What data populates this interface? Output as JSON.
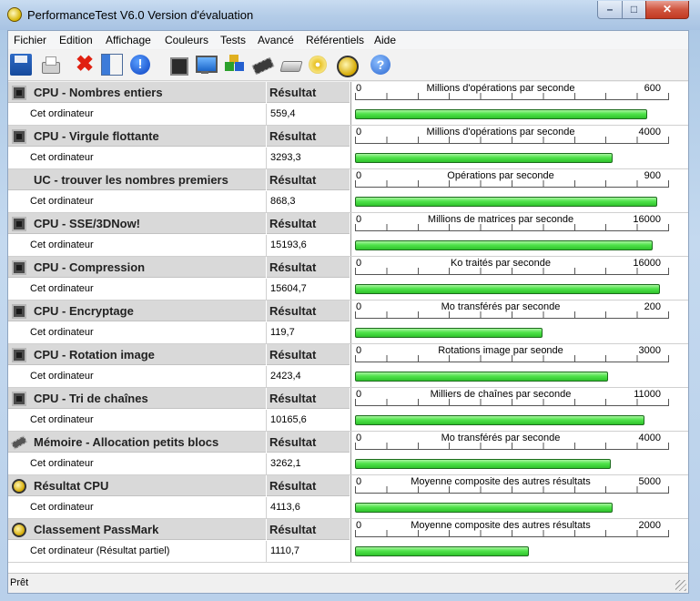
{
  "window": {
    "title": "PerformanceTest V6.0 Version d'évaluation",
    "buttons": {
      "minimize": "–",
      "maximize": "□",
      "close": "✕"
    }
  },
  "menu": [
    "Fichier",
    "Edition",
    "Affichage",
    "Couleurs",
    "Tests",
    "Avancé",
    "Référentiels",
    "Aide"
  ],
  "toolbar": {
    "icons": [
      "save-icon",
      "print-icon",
      "delete-icon",
      "report-icon",
      "info-icon",
      "stop-icon",
      "monitor-icon",
      "cubes-icon",
      "memory-chip-icon",
      "disk-drive-icon",
      "cd-icon",
      "passmark-icon",
      "help-icon"
    ],
    "delete_glyph": "✖",
    "info_glyph": "!",
    "help_glyph": "?"
  },
  "colors": {
    "bar_green": "#4fe34a",
    "header_gray": "#d9d9d9"
  },
  "result_col": "Résultat",
  "tests": [
    {
      "name": "CPU - Nombres entiers",
      "icon": "chip-icon",
      "who": "Cet ordinateur",
      "value": "559,4",
      "unit": "Millions d'opérations par seconde",
      "min": "0",
      "max": "600",
      "fraction": 0.932
    },
    {
      "name": "CPU - Virgule flottante",
      "icon": "chip-icon",
      "who": "Cet ordinateur",
      "value": "3293,3",
      "unit": "Millions d'opérations par seconde",
      "min": "0",
      "max": "4000",
      "fraction": 0.823
    },
    {
      "name": "UC - trouver les nombres premiers",
      "icon": "none",
      "who": "Cet ordinateur",
      "value": "868,3",
      "unit": "Opérations par seconde",
      "min": "0",
      "max": "900",
      "fraction": 0.965
    },
    {
      "name": "CPU - SSE/3DNow!",
      "icon": "chip-icon",
      "who": "Cet ordinateur",
      "value": "15193,6",
      "unit": "Millions de matrices par seconde",
      "min": "0",
      "max": "16000",
      "fraction": 0.95
    },
    {
      "name": "CPU - Compression",
      "icon": "chip-icon",
      "who": "Cet ordinateur",
      "value": "15604,7",
      "unit": "Ko traités par seconde",
      "min": "0",
      "max": "16000",
      "fraction": 0.975
    },
    {
      "name": "CPU - Encryptage",
      "icon": "chip-icon",
      "who": "Cet ordinateur",
      "value": "119,7",
      "unit": "Mo transférés par seconde",
      "min": "0",
      "max": "200",
      "fraction": 0.599
    },
    {
      "name": "CPU - Rotation image",
      "icon": "chip-icon",
      "who": "Cet ordinateur",
      "value": "2423,4",
      "unit": "Rotations image par seonde",
      "min": "0",
      "max": "3000",
      "fraction": 0.808
    },
    {
      "name": "CPU - Tri de chaînes",
      "icon": "chip-icon",
      "who": "Cet ordinateur",
      "value": "10165,6",
      "unit": "Milliers de chaînes par seconde",
      "min": "0",
      "max": "11000",
      "fraction": 0.924
    },
    {
      "name": "Mémoire - Allocation petits blocs",
      "icon": "memory-icon",
      "who": "Cet ordinateur",
      "value": "3262,1",
      "unit": "Mo transférés par seconde",
      "min": "0",
      "max": "4000",
      "fraction": 0.816
    },
    {
      "name": "Résultat CPU",
      "icon": "passmark-icon",
      "who": "Cet ordinateur",
      "value": "4113,6",
      "unit": "Moyenne composite des autres résultats",
      "min": "0",
      "max": "5000",
      "fraction": 0.823
    },
    {
      "name": "Classement PassMark",
      "icon": "passmark-icon",
      "who": "Cet ordinateur (Résultat partiel)",
      "value": "1110,7",
      "unit": "Moyenne composite des autres résultats",
      "min": "0",
      "max": "2000",
      "fraction": 0.555
    }
  ],
  "status": "Prêt"
}
